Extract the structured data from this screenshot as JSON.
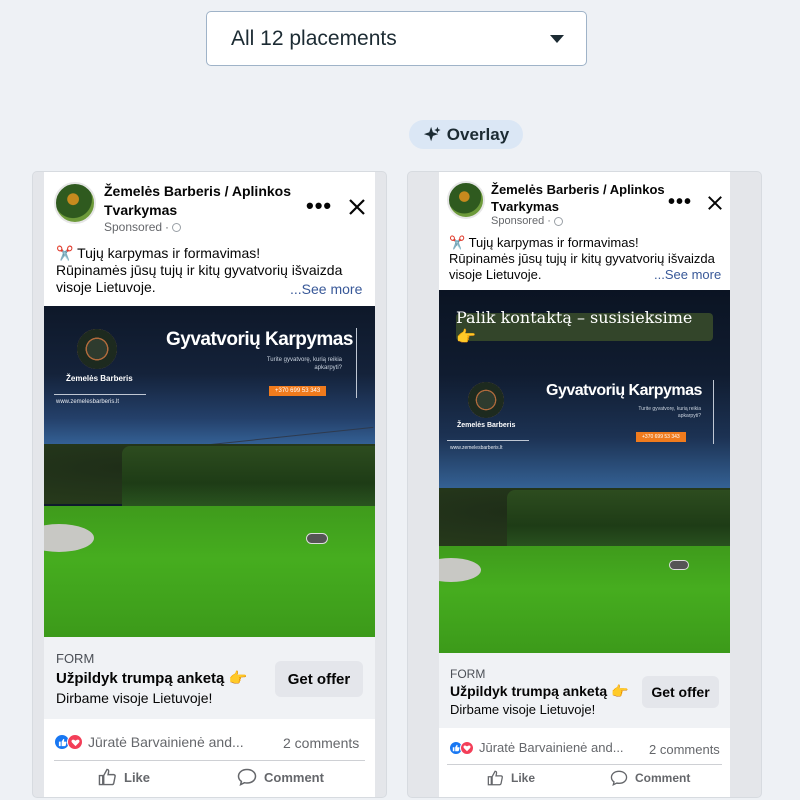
{
  "placements_dropdown": {
    "label": "All 12 placements"
  },
  "overlay_badge": {
    "label": "Overlay"
  },
  "post": {
    "page_name": "Žemelės Barberis / Aplinkos Tvarkymas",
    "sponsored": "Sponsored",
    "body_line1": "✂️ Tujų karpymas ir formavimas!",
    "body_line2": "Rūpinamės jūsų tujų ir kitų gyvatvorių išvaizda visoje Lietuvoje.",
    "see_more": "...See more"
  },
  "creative": {
    "headline": "Gyvatvorių Karpymas",
    "subline": "Turite gyvatvorę, kurią reikia apkarpyti?",
    "phone": "+370 699 53 343",
    "brand": "Žemelės Barberis",
    "url": "www.zemelesbarberis.lt",
    "overlay_caption": "Palik kontaktą – susisieksime 👉"
  },
  "cta": {
    "form_label": "FORM",
    "title": "Užpildyk trumpą anketą 👉",
    "subtitle": "Dirbame visoje Lietuvoje!",
    "button": "Get offer"
  },
  "engagement": {
    "names": "Jūratė Barvainienė and...",
    "comments": "2 comments",
    "like": "Like",
    "comment": "Comment"
  },
  "colors": {
    "phone_pill": "#f07b1d",
    "like_blue": "#1877f2",
    "love_red": "#f33e58",
    "overlay_caption_bg": "#33452a"
  }
}
